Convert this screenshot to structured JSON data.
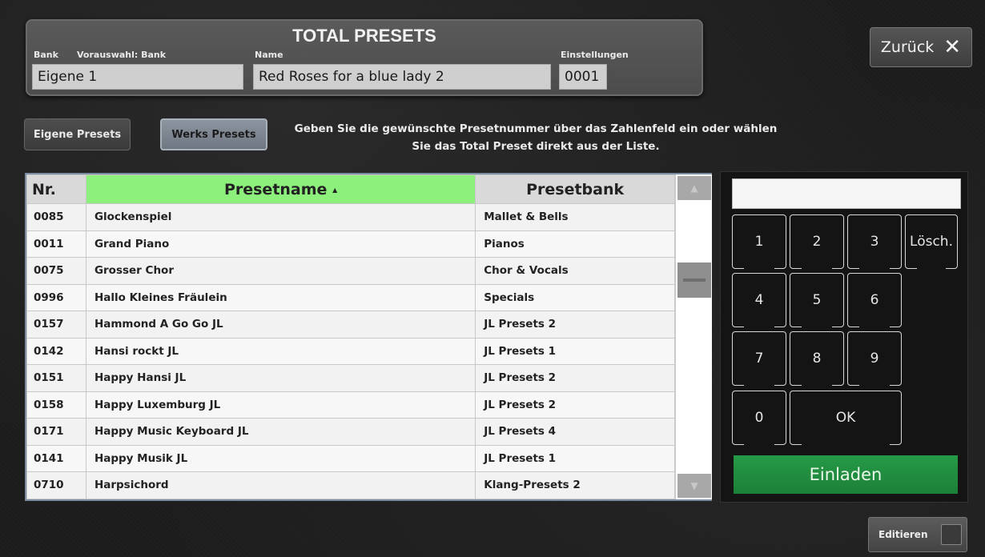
{
  "header": {
    "title": "TOTAL PRESETS",
    "bank_label": "Bank",
    "preselect_label": "Vorauswahl: Bank",
    "name_label": "Name",
    "settings_label": "Einstellungen",
    "bank_value": "Eigene 1",
    "name_value": "Red Roses for a blue lady 2",
    "settings_value": "0001"
  },
  "back_button": {
    "label": "Zurück",
    "icon": "close-icon"
  },
  "tabs": {
    "own": "Eigene Presets",
    "works": "Werks Presets"
  },
  "instruction": {
    "line1": "Geben Sie die gewünschte Presetnummer über das Zahlenfeld ein oder wählen",
    "line2": "Sie das Total Preset direkt aus der Liste."
  },
  "table": {
    "headers": {
      "nr": "Nr.",
      "name": "Presetname",
      "sort_indicator": "▲",
      "bank": "Presetbank"
    },
    "rows": [
      {
        "nr": "0085",
        "name": "Glockenspiel",
        "bank": "Mallet & Bells"
      },
      {
        "nr": "0011",
        "name": "Grand Piano",
        "bank": "Pianos"
      },
      {
        "nr": "0075",
        "name": "Grosser Chor",
        "bank": "Chor & Vocals"
      },
      {
        "nr": "0996",
        "name": "Hallo Kleines Fräulein",
        "bank": "Specials"
      },
      {
        "nr": "0157",
        "name": "Hammond A Go Go JL",
        "bank": "JL Presets 2"
      },
      {
        "nr": "0142",
        "name": "Hansi rockt  JL",
        "bank": "JL Presets 1"
      },
      {
        "nr": "0151",
        "name": "Happy Hansi JL",
        "bank": "JL Presets 2"
      },
      {
        "nr": "0158",
        "name": "Happy Luxemburg JL",
        "bank": "JL Presets 2"
      },
      {
        "nr": "0171",
        "name": "Happy Music Keyboard JL",
        "bank": "JL Presets 4"
      },
      {
        "nr": "0141",
        "name": "Happy Musik JL",
        "bank": "JL Presets 1"
      },
      {
        "nr": "0710",
        "name": "Harpsichord",
        "bank": "Klang-Presets 2"
      }
    ]
  },
  "numpad": {
    "display": "",
    "keys": {
      "k1": "1",
      "k2": "2",
      "k3": "3",
      "del": "Lösch.",
      "k4": "4",
      "k5": "5",
      "k6": "6",
      "k7": "7",
      "k8": "8",
      "k9": "9",
      "k0": "0",
      "ok": "OK"
    },
    "load_label": "Einladen"
  },
  "edit_button": {
    "label": "Editieren"
  },
  "colors": {
    "sorted_header": "#8ef07c",
    "load_button": "#23913f",
    "table_border": "#7a8ca0"
  }
}
